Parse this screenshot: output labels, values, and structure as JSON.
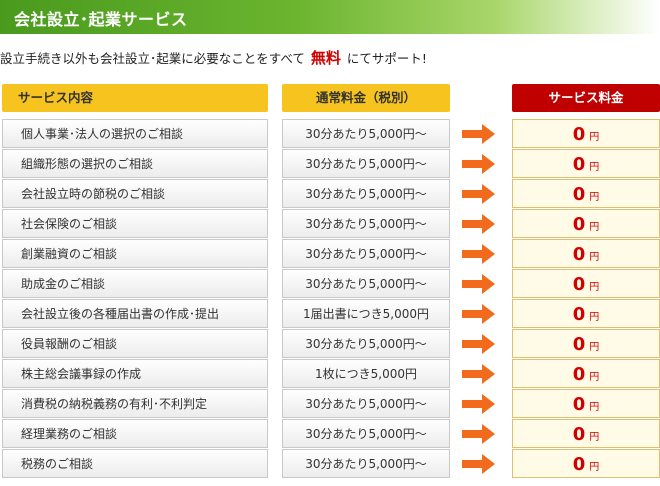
{
  "header": {
    "title": "会社設立･起業サービス"
  },
  "intro": {
    "before": "設立手続き以外も会社設立･起業に必要なことをすべて",
    "free": "無料",
    "after": "にてサポート!"
  },
  "columns": {
    "service": "サービス内容",
    "price": "通常料金（税別）",
    "fee": "サービス料金"
  },
  "rows": [
    {
      "name": "個人事業･法人の選択のご相談",
      "price": "30分あたり5,000円～",
      "fee": "0",
      "unit": "円"
    },
    {
      "name": "組織形態の選択のご相談",
      "price": "30分あたり5,000円～",
      "fee": "0",
      "unit": "円"
    },
    {
      "name": "会社設立時の節税のご相談",
      "price": "30分あたり5,000円～",
      "fee": "0",
      "unit": "円"
    },
    {
      "name": "社会保険のご相談",
      "price": "30分あたり5,000円～",
      "fee": "0",
      "unit": "円"
    },
    {
      "name": "創業融資のご相談",
      "price": "30分あたり5,000円～",
      "fee": "0",
      "unit": "円"
    },
    {
      "name": "助成金のご相談",
      "price": "30分あたり5,000円～",
      "fee": "0",
      "unit": "円"
    },
    {
      "name": "会社設立後の各種届出書の作成･提出",
      "price": "1届出書につき5,000円",
      "fee": "0",
      "unit": "円"
    },
    {
      "name": "役員報酬のご相談",
      "price": "30分あたり5,000円～",
      "fee": "0",
      "unit": "円"
    },
    {
      "name": "株主総会議事録の作成",
      "price": "1枚につき5,000円",
      "fee": "0",
      "unit": "円"
    },
    {
      "name": "消費税の納税義務の有利･不利判定",
      "price": "30分あたり5,000円～",
      "fee": "0",
      "unit": "円"
    },
    {
      "name": "経理業務のご相談",
      "price": "30分あたり5,000円～",
      "fee": "0",
      "unit": "円"
    },
    {
      "name": "税務のご相談",
      "price": "30分あたり5,000円～",
      "fee": "0",
      "unit": "円"
    }
  ],
  "colors": {
    "header_green": "#4a9a1e",
    "column_yellow": "#f7c41f",
    "fee_red": "#c00000",
    "arrow_orange": "#f26b1d",
    "free_red": "#d30000"
  },
  "icons": {
    "row_arrow": "right-arrow-icon"
  }
}
